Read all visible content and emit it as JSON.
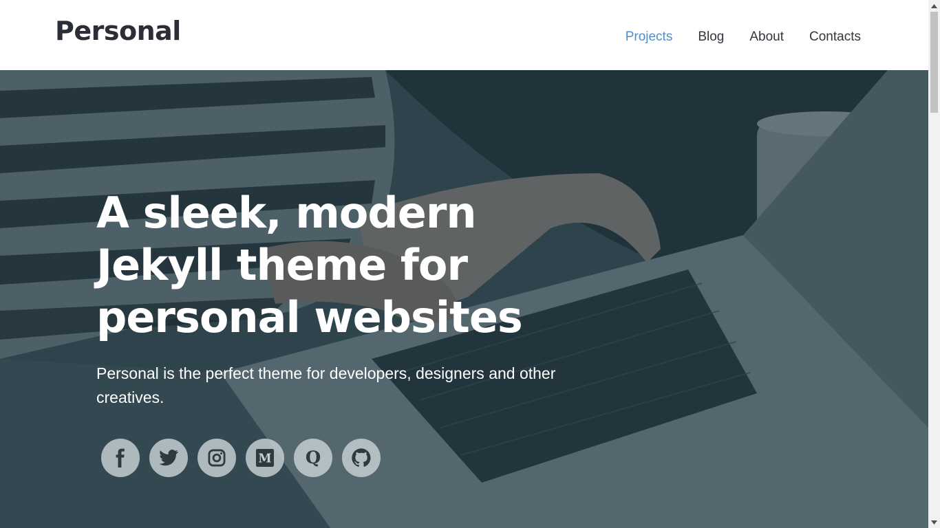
{
  "header": {
    "brand": "Personal",
    "nav": [
      {
        "label": "Projects",
        "active": true
      },
      {
        "label": "Blog",
        "active": false
      },
      {
        "label": "About",
        "active": false
      },
      {
        "label": "Contacts",
        "active": false
      }
    ]
  },
  "hero": {
    "title": "A sleek, modern Jekyll theme for personal websites",
    "subtitle": "Personal is the perfect theme for developers, designers and other creatives.",
    "socials": [
      {
        "icon": "facebook-icon"
      },
      {
        "icon": "twitter-icon"
      },
      {
        "icon": "instagram-icon"
      },
      {
        "icon": "medium-icon"
      },
      {
        "icon": "quora-icon"
      },
      {
        "icon": "github-icon"
      }
    ]
  },
  "colors": {
    "accent": "#4a8fd0",
    "brand_text": "#2b2e36",
    "hero_overlay": "#182c34",
    "social_bg": "#c8d2d4",
    "icon_color": "#2d3a40"
  }
}
